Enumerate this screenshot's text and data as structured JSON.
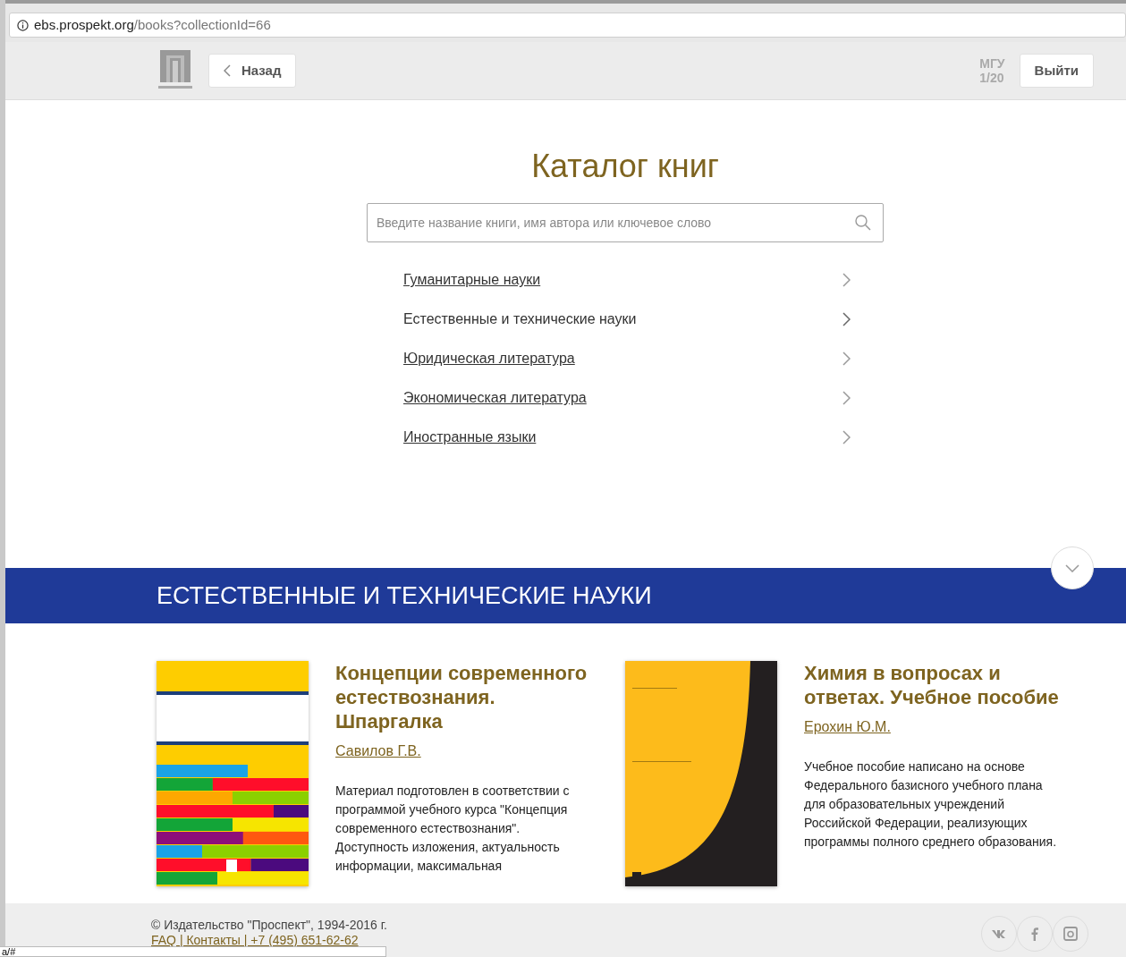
{
  "browser": {
    "url_host": "ebs.prospekt.org",
    "url_path": "/books?collectionId=66",
    "status_text": "a/#"
  },
  "header": {
    "back_label": "Назад",
    "org": "МГУ",
    "counter": "1/20",
    "logout_label": "Выйти"
  },
  "catalog": {
    "title": "Каталог книг",
    "search": {
      "placeholder": "Введите название книги, имя автора или ключевое слово"
    },
    "categories": [
      {
        "label": "Гуманитарные науки",
        "selected": false
      },
      {
        "label": "Естественные и технические науки",
        "selected": true
      },
      {
        "label": "Юридическая литература",
        "selected": false
      },
      {
        "label": "Экономическая литература",
        "selected": false
      },
      {
        "label": "Иностранные языки",
        "selected": false
      }
    ]
  },
  "section": {
    "title": "ЕСТЕСТВЕННЫЕ И ТЕХНИЧЕСКИЕ НАУКИ"
  },
  "books": [
    {
      "kind": "stripes",
      "title": "Концепции современного естествознания. Шпаргалка",
      "author": "Савилов Г.В.",
      "description": "Материал подготовлен в соответствии с программой учебного курса \"Концепция современного естествознания\". Доступность изложения, актуальность информации, максимальная"
    },
    {
      "kind": "curve",
      "title": "Химия в вопросах и ответах. Учебное пособие",
      "author": "Ерохин Ю.М.",
      "description": "Учебное пособие написано на основе Федерального базисного учебного плана для образовательных учреждений Российской Федерации, реализующих программы полного среднего образования."
    }
  ],
  "footer": {
    "copyright": "© Издательство \"Проспект\", 1994-2016 г.",
    "links": "FAQ | Контакты | +7 (495) 651-62-62"
  }
}
